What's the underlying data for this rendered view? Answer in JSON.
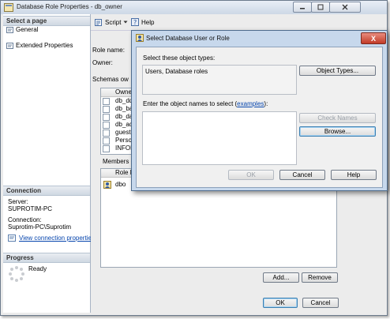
{
  "main_window": {
    "title": "Database Role Properties - db_owner",
    "select_page_header": "Select a page",
    "pages": [
      "General",
      "Extended Properties"
    ],
    "toolbar": {
      "script_label": "Script",
      "help_label": "Help"
    },
    "role_name_label": "Role name:",
    "owner_label": "Owner:",
    "schemas_label": "Schemas ow",
    "schemas_column": "Owned",
    "schemas_rows": [
      "db_dd",
      "db_ba",
      "db_da",
      "db_ac",
      "guest",
      "Person",
      "INFOF"
    ],
    "members_label": "Members of",
    "members_column": "Role M",
    "members_rows": [
      "dbo"
    ],
    "connection_header": "Connection",
    "server_label": "Server:",
    "server_value": "SUPROTIM-PC",
    "connection_label": "Connection:",
    "connection_value": "Suprotim-PC\\Suprotim",
    "view_connection_link": "View connection properties",
    "progress_header": "Progress",
    "progress_status": "Ready",
    "add_button": "Add...",
    "remove_button": "Remove",
    "ok_button": "OK",
    "cancel_button": "Cancel"
  },
  "dialog": {
    "title": "Select Database User or Role",
    "close_glyph": "X",
    "object_types_label": "Select these object types:",
    "object_types_value": "Users, Database roles",
    "object_types_button": "Object Types...",
    "names_label_prefix": "Enter the object names to select (",
    "names_label_link": "examples",
    "names_label_suffix": "):",
    "check_names_button": "Check Names",
    "browse_button": "Browse...",
    "ok_button": "OK",
    "cancel_button": "Cancel",
    "help_button": "Help"
  }
}
